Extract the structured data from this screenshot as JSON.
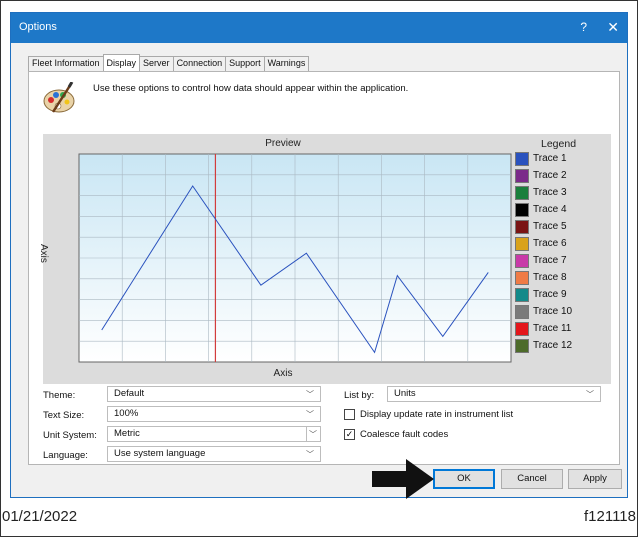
{
  "window": {
    "title": "Options",
    "help_glyph": "?",
    "close_glyph": "✕"
  },
  "tabs": [
    {
      "label": "Fleet Information",
      "active": false
    },
    {
      "label": "Display",
      "active": true
    },
    {
      "label": "Server",
      "active": false
    },
    {
      "label": "Connection",
      "active": false
    },
    {
      "label": "Support",
      "active": false
    },
    {
      "label": "Warnings",
      "active": false
    }
  ],
  "description": "Use these options to control how data should appear within the application.",
  "chart_data": {
    "type": "line",
    "title": "Preview",
    "xlabel": "Axis",
    "ylabel": "Axis",
    "legend_title": "Legend",
    "legend_placement": "right",
    "grid": true,
    "series": [
      {
        "name": "Trace 1",
        "color": "#2a52be"
      },
      {
        "name": "Trace 2",
        "color": "#7b2a8a"
      },
      {
        "name": "Trace 3",
        "color": "#1a7f3c"
      },
      {
        "name": "Trace 4",
        "color": "#000000"
      },
      {
        "name": "Trace 5",
        "color": "#7a1414"
      },
      {
        "name": "Trace 6",
        "color": "#d9a21b"
      },
      {
        "name": "Trace 7",
        "color": "#c83aa8"
      },
      {
        "name": "Trace 8",
        "color": "#ef7b45"
      },
      {
        "name": "Trace 9",
        "color": "#138a8a"
      },
      {
        "name": "Trace 10",
        "color": "#7a7a7a"
      },
      {
        "name": "Trace 11",
        "color": "#e4161c"
      },
      {
        "name": "Trace 12",
        "color": "#4d6b2a"
      }
    ],
    "line_points": [
      [
        1,
        1
      ],
      [
        3,
        5.5
      ],
      [
        4.5,
        2.4
      ],
      [
        5.5,
        3.4
      ],
      [
        7,
        0.3
      ],
      [
        7.5,
        2.7
      ],
      [
        8.5,
        0.8
      ],
      [
        9.5,
        2.8
      ]
    ],
    "cursor_x": 3.5,
    "xlim": [
      0.5,
      10
    ],
    "ylim": [
      0,
      6.5
    ],
    "trace_color": "#2a52be",
    "cursor_color": "#d23c3c"
  },
  "settings": {
    "theme_label": "Theme:",
    "theme_value": "Default",
    "text_size_label": "Text Size:",
    "text_size_value": "100%",
    "unit_system_label": "Unit System:",
    "unit_system_value": "Metric",
    "language_label": "Language:",
    "language_value": "Use system language",
    "list_by_label": "List by:",
    "list_by_value": "Units",
    "display_update_rate_label": "Display update rate in instrument list",
    "display_update_rate_checked": false,
    "coalesce_label": "Coalesce fault codes",
    "coalesce_checked": true
  },
  "buttons": {
    "ok": "OK",
    "cancel": "Cancel",
    "apply": "Apply"
  },
  "footer": {
    "date": "01/21/2022",
    "figure_id": "f121118"
  },
  "colors": {
    "titlebar": "#1e78c8",
    "accent": "#0078d7"
  }
}
